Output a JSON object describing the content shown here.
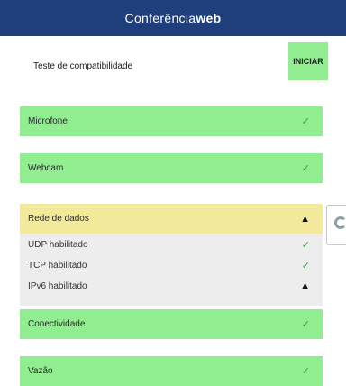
{
  "header": {
    "logo_prefix": "Conferência",
    "logo_suffix": "web"
  },
  "compat": {
    "label": "Teste de compatibilidade",
    "start_label": "INICIAR"
  },
  "tests": [
    {
      "label": "Microfone",
      "status": "ok"
    },
    {
      "label": "Webcam",
      "status": "ok"
    },
    {
      "label": "Rede de dados",
      "status": "warning"
    },
    {
      "label": "Conectividade",
      "status": "ok"
    },
    {
      "label": "Vazão",
      "status": "ok"
    }
  ],
  "network_details": [
    {
      "label": "UDP habilitado",
      "status": "ok"
    },
    {
      "label": "TCP habilitado",
      "status": "ok"
    },
    {
      "label": "IPv6 habilitado",
      "status": "warning"
    }
  ],
  "icons": {
    "ok": "✓",
    "warning": "▲"
  },
  "colors": {
    "header_bg": "#1f3f7c",
    "ok_bg": "#90ee90",
    "warn_bg": "#f2ea9a",
    "check_color": "#3a9a3a"
  }
}
